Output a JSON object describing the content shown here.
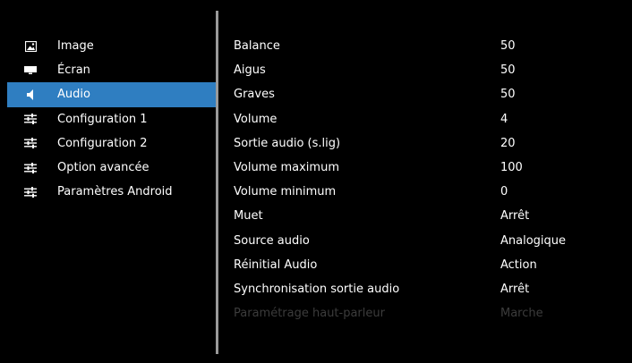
{
  "sidebar": {
    "items": [
      {
        "label": "Image",
        "icon": "image-icon"
      },
      {
        "label": "Écran",
        "icon": "screen-icon"
      },
      {
        "label": "Audio",
        "icon": "speaker-icon"
      },
      {
        "label": "Configuration 1",
        "icon": "sliders-icon"
      },
      {
        "label": "Configuration 2",
        "icon": "sliders-icon"
      },
      {
        "label": "Option avancée",
        "icon": "sliders-icon"
      },
      {
        "label": "Paramètres Android",
        "icon": "sliders-icon"
      }
    ],
    "active_index": 2
  },
  "settings": {
    "rows": [
      {
        "label": "Balance",
        "value": "50"
      },
      {
        "label": "Aigus",
        "value": "50"
      },
      {
        "label": "Graves",
        "value": "50"
      },
      {
        "label": "Volume",
        "value": "4"
      },
      {
        "label": "Sortie audio (s.lig)",
        "value": "20"
      },
      {
        "label": "Volume maximum",
        "value": "100"
      },
      {
        "label": "Volume minimum",
        "value": "0"
      },
      {
        "label": "Muet",
        "value": "Arrêt"
      },
      {
        "label": "Source audio",
        "value": "Analogique"
      },
      {
        "label": "Réinitial Audio",
        "value": "Action"
      },
      {
        "label": "Synchronisation sortie audio",
        "value": "Arrêt"
      },
      {
        "label": "Paramétrage haut-parleur",
        "value": "Marche"
      }
    ]
  },
  "colors": {
    "background": "#000000",
    "active_highlight": "#2f7ec1",
    "divider": "#9a9a9a",
    "disabled_text": "#3c3c3c",
    "text": "#ffffff"
  }
}
